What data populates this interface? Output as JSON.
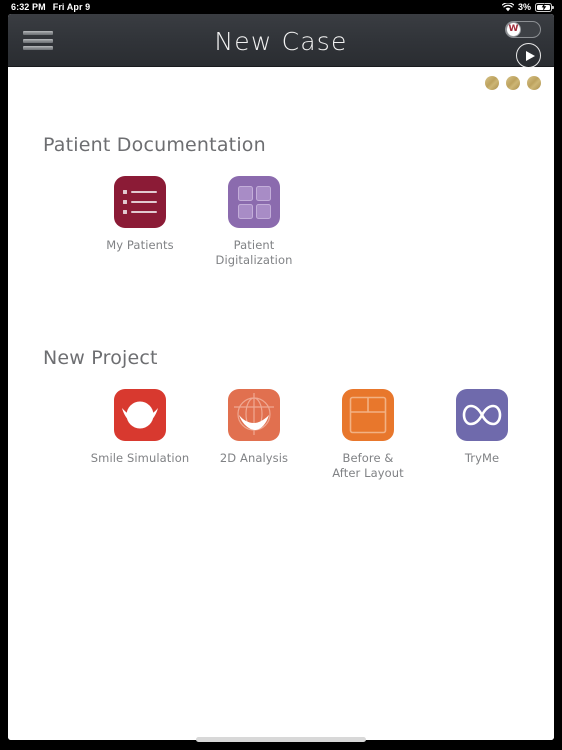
{
  "statusbar": {
    "time": "6:32 PM",
    "date": "Fri Apr 9",
    "battery_percent": "3%",
    "wifi_icon": "wifi-icon",
    "battery_icon": "battery-charging-icon"
  },
  "navbar": {
    "title": "New Case",
    "menu_icon": "hamburger-menu-icon",
    "toggle_label": "W",
    "play_icon": "play-icon"
  },
  "badges": {
    "dot_icon": "gold-dot-icon",
    "count": 3
  },
  "sections": [
    {
      "title": "Patient Documentation",
      "items": [
        {
          "label": "My Patients",
          "tile_class": "t-maroon",
          "icon": "patient-list-icon",
          "color": "#8b1b36"
        },
        {
          "label": "Patient Digitalization",
          "tile_class": "t-purple",
          "icon": "grid-quadrant-icon",
          "color": "#8b6bae"
        }
      ]
    },
    {
      "title": "New Project",
      "items": [
        {
          "label": "Smile Simulation",
          "tile_class": "t-red",
          "icon": "smile-simulation-icon",
          "color": "#d8392f"
        },
        {
          "label": "2D Analysis",
          "tile_class": "t-salmon",
          "icon": "2d-analysis-icon",
          "color": "#e1704f"
        },
        {
          "label": "Before &\nAfter Layout",
          "tile_class": "t-orange",
          "icon": "layout-frame-icon",
          "color": "#e8772c"
        },
        {
          "label": "TryMe",
          "tile_class": "t-indigo",
          "icon": "infinity-icon",
          "color": "#6f6aac"
        }
      ]
    }
  ],
  "home_indicator": "home-indicator-bar"
}
